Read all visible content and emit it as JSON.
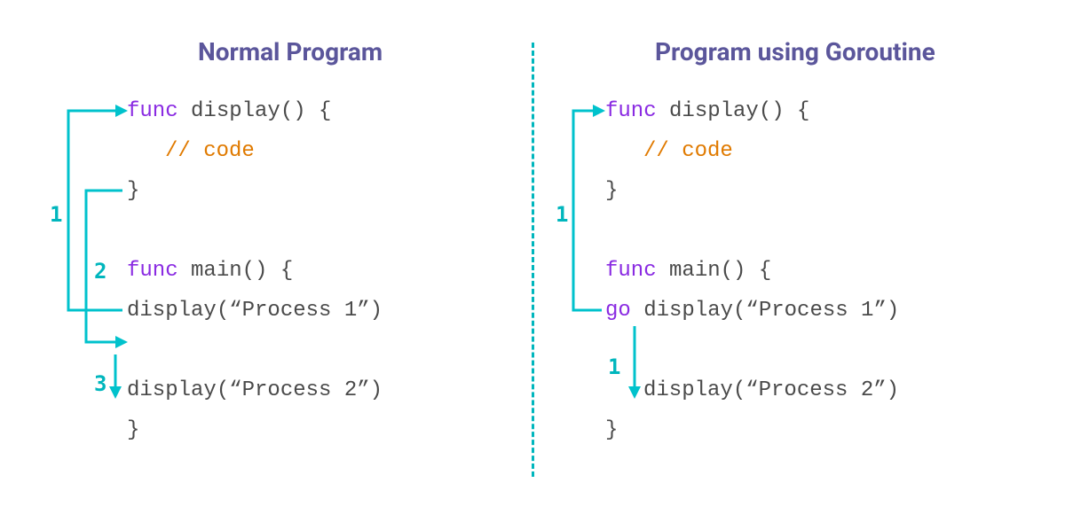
{
  "colors": {
    "title": "#5b569b",
    "keyword": "#8a2be2",
    "comment": "#e07a00",
    "arrow": "#00c2cc",
    "text": "#4a4a4a"
  },
  "left": {
    "title": "Normal Program",
    "lines": {
      "l1_kw": "func",
      "l1_rest": " display() {",
      "l2_cm": "// code",
      "l3": "}",
      "l4_kw": "func",
      "l4_rest": " main() {",
      "l5": "display(“Process 1”)",
      "l6": "display(“Process 2”)",
      "l7": "}"
    },
    "steps": {
      "s1": "1",
      "s2": "2",
      "s3": "3"
    }
  },
  "right": {
    "title": "Program using Goroutine",
    "lines": {
      "l1_kw": "func",
      "l1_rest": " display() {",
      "l2_cm": "// code",
      "l3": "}",
      "l4_kw": "func",
      "l4_rest": " main() {",
      "l5_kw": "go",
      "l5_rest": " display(“Process 1”)",
      "l6": "display(“Process 2”)",
      "l7": "}"
    },
    "steps": {
      "s1": "1",
      "s2": "1"
    }
  }
}
